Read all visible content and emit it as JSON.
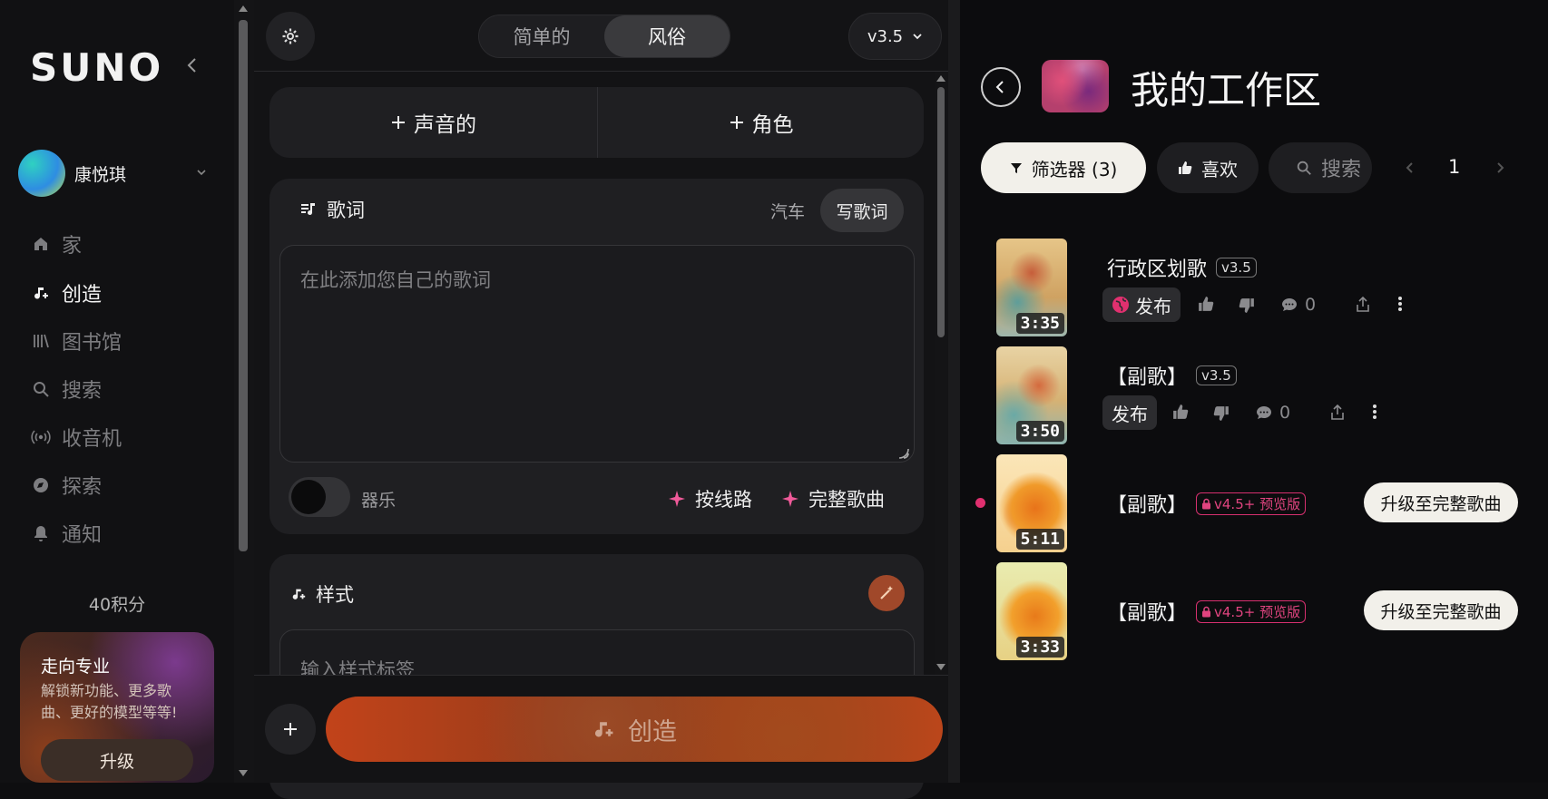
{
  "sidebar": {
    "logo": "SUNO",
    "user": {
      "name": "康悦琪"
    },
    "nav": [
      {
        "label": "家",
        "icon": "home-icon"
      },
      {
        "label": "创造",
        "icon": "music-note-plus-icon",
        "active": true
      },
      {
        "label": "图书馆",
        "icon": "library-icon"
      },
      {
        "label": "搜索",
        "icon": "search-icon"
      },
      {
        "label": "收音机",
        "icon": "radio-icon"
      },
      {
        "label": "探索",
        "icon": "compass-icon"
      },
      {
        "label": "通知",
        "icon": "bell-icon"
      }
    ],
    "credits": "40积分",
    "promo": {
      "title": "走向专业",
      "text": "解锁新功能、更多歌曲、更好的模型等等!",
      "button": "升级"
    }
  },
  "create": {
    "mode_tabs": [
      "简单的",
      "风俗"
    ],
    "active_mode": "风俗",
    "version": "v3.5",
    "add_buttons": [
      "声音的",
      "角色"
    ],
    "lyrics": {
      "title": "歌词",
      "tabs": [
        "汽车",
        "写歌词"
      ],
      "placeholder": "在此添加您自己的歌词",
      "instrumental_label": "器乐",
      "actions": [
        "按线路",
        "完整歌曲"
      ]
    },
    "style": {
      "title": "样式",
      "placeholder": "输入样式标签"
    },
    "create_button": "创造"
  },
  "workspace": {
    "title": "我的工作区",
    "filters": {
      "filter_label": "筛选器 (3)",
      "like_label": "喜欢",
      "search_label": "搜索"
    },
    "page": "1",
    "songs": [
      {
        "title": "行政区划歌",
        "version": "v3.5",
        "duration": "3:35",
        "publish": "发布",
        "comments": "0",
        "published_globe": true
      },
      {
        "title": "【副歌】",
        "version": "v3.5",
        "duration": "3:50",
        "publish": "发布",
        "comments": "0"
      },
      {
        "title": "【副歌】",
        "version": "v4.5+ 预览版",
        "duration": "5:11",
        "upgrade": "升级至完整歌曲",
        "new_dot": true
      },
      {
        "title": "【副歌】",
        "version": "v4.5+ 预览版",
        "duration": "3:33",
        "upgrade": "升级至完整歌曲"
      }
    ]
  },
  "colors": {
    "accent_pink": "#e0306f",
    "create_orange": "#c2431a",
    "spark_pink": "#f05a9a"
  }
}
